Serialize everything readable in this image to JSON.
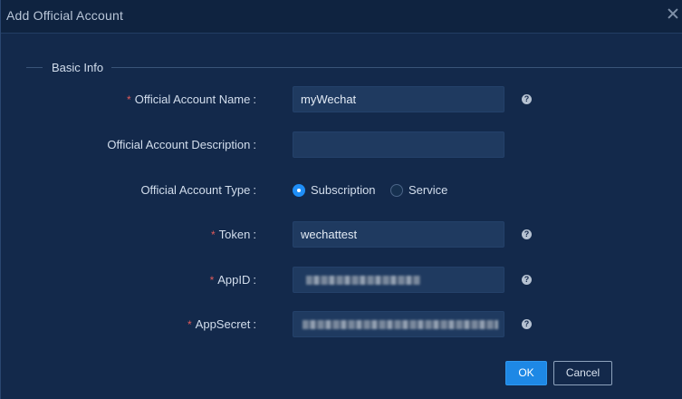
{
  "dialog": {
    "title": "Add Official Account",
    "section_title": "Basic Info"
  },
  "form": {
    "name": {
      "label": "Official Account Name",
      "required_mark": "*",
      "colon": ":",
      "value": "myWechat",
      "help": "?"
    },
    "description": {
      "label": "Official Account Description",
      "colon": ":",
      "value": ""
    },
    "type": {
      "label": "Official Account Type",
      "colon": ":",
      "options": [
        "Subscription",
        "Service"
      ],
      "selected": "Subscription"
    },
    "token": {
      "label": "Token",
      "required_mark": "*",
      "colon": ":",
      "value": "wechattest",
      "help": "?"
    },
    "appid": {
      "label": "AppID",
      "required_mark": "*",
      "colon": ":",
      "value_masked": true,
      "help": "?"
    },
    "appsecret": {
      "label": "AppSecret",
      "required_mark": "*",
      "colon": ":",
      "value_masked": true,
      "help": "?"
    }
  },
  "buttons": {
    "ok": "OK",
    "cancel": "Cancel"
  },
  "colors": {
    "background": "#13294b",
    "input_bg": "#1f3a60",
    "primary": "#1e88e5",
    "required": "#e05a5a"
  },
  "icons": {
    "close": "close-icon",
    "help": "help-icon"
  }
}
